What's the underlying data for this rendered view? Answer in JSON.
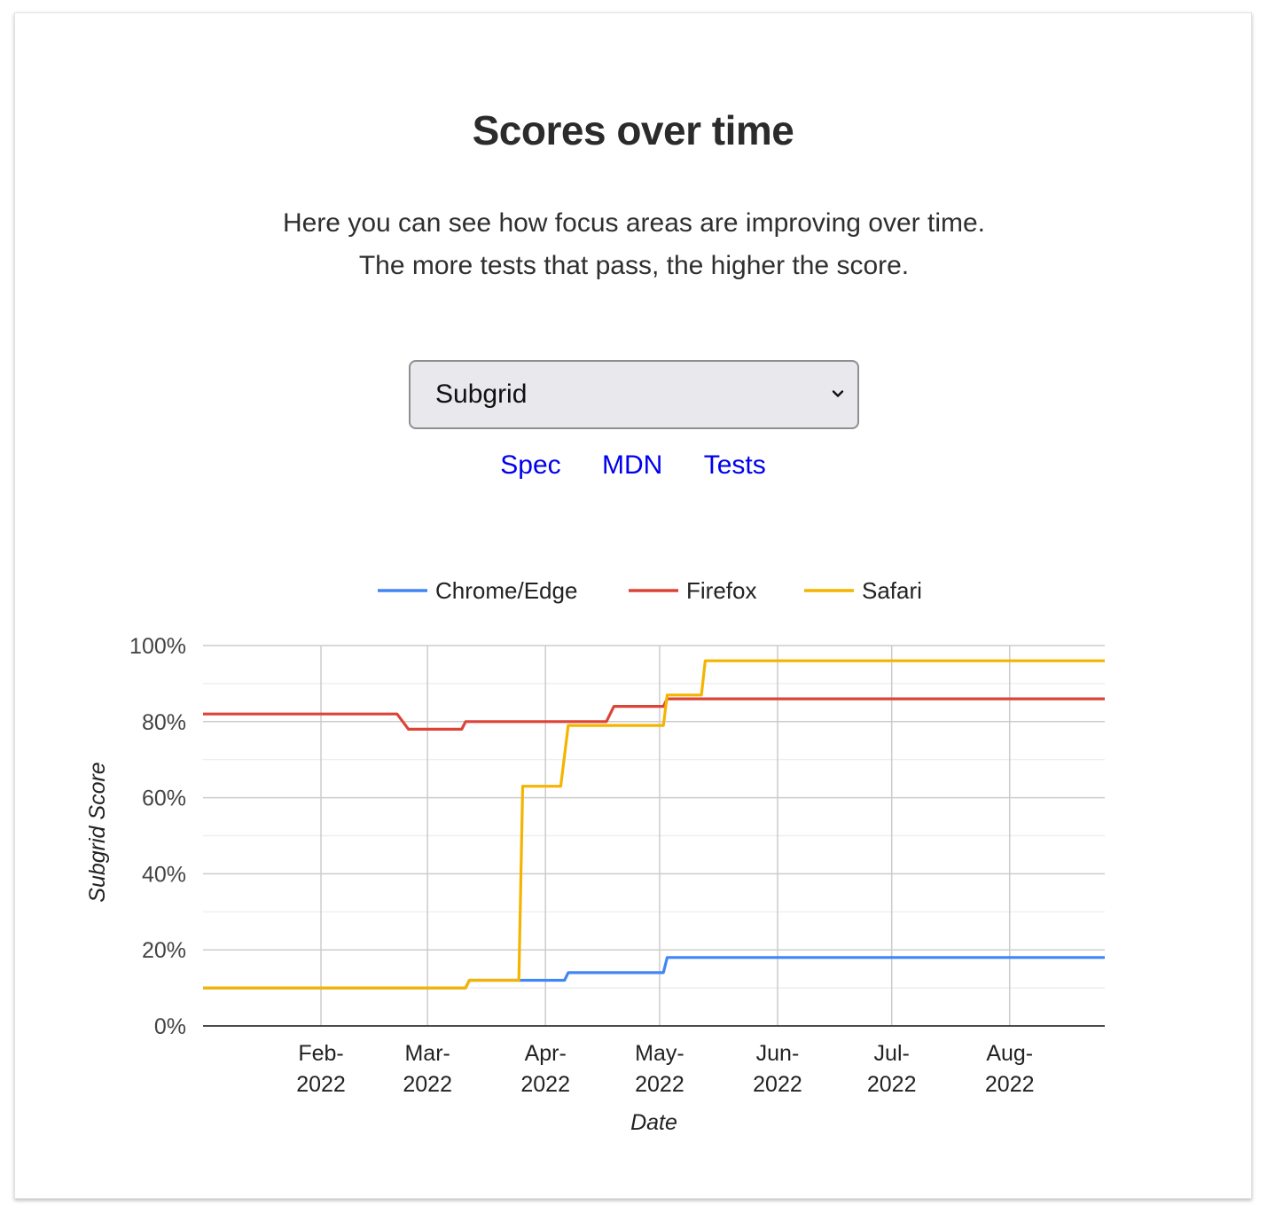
{
  "header": {
    "title": "Scores over time",
    "description": "Here you can see how focus areas are improving over time. The more tests that pass, the higher the score."
  },
  "select": {
    "selected": "Subgrid"
  },
  "links": [
    {
      "label": "Spec"
    },
    {
      "label": "MDN"
    },
    {
      "label": "Tests"
    }
  ],
  "chart_data": {
    "type": "line",
    "step": true,
    "xlabel": "Date",
    "ylabel": "Subgrid Score",
    "ylim": [
      0,
      100
    ],
    "xlim": [
      "2022-01-01",
      "2022-08-26"
    ],
    "yticks": [
      "0%",
      "20%",
      "40%",
      "60%",
      "80%",
      "100%"
    ],
    "xticks": [
      {
        "date": "2022-02-01",
        "line1": "Feb-",
        "line2": "2022"
      },
      {
        "date": "2022-03-01",
        "line1": "Mar-",
        "line2": "2022"
      },
      {
        "date": "2022-04-01",
        "line1": "Apr-",
        "line2": "2022"
      },
      {
        "date": "2022-05-01",
        "line1": "May-",
        "line2": "2022"
      },
      {
        "date": "2022-06-01",
        "line1": "Jun-",
        "line2": "2022"
      },
      {
        "date": "2022-07-01",
        "line1": "Jul-",
        "line2": "2022"
      },
      {
        "date": "2022-08-01",
        "line1": "Aug-",
        "line2": "2022"
      }
    ],
    "grid": true,
    "legend": "top",
    "series": [
      {
        "name": "Chrome/Edge",
        "color": "#4285f4",
        "points": [
          [
            "2022-01-01",
            10
          ],
          [
            "2022-03-11",
            10
          ],
          [
            "2022-03-12",
            12
          ],
          [
            "2022-04-06",
            12
          ],
          [
            "2022-04-07",
            14
          ],
          [
            "2022-05-02",
            14
          ],
          [
            "2022-05-03",
            18
          ],
          [
            "2022-08-26",
            18
          ]
        ]
      },
      {
        "name": "Firefox",
        "color": "#db4437",
        "points": [
          [
            "2022-01-01",
            82
          ],
          [
            "2022-02-21",
            82
          ],
          [
            "2022-02-24",
            78
          ],
          [
            "2022-03-10",
            78
          ],
          [
            "2022-03-11",
            80
          ],
          [
            "2022-04-17",
            80
          ],
          [
            "2022-04-19",
            84
          ],
          [
            "2022-05-02",
            84
          ],
          [
            "2022-05-03",
            86
          ],
          [
            "2022-08-26",
            86
          ]
        ]
      },
      {
        "name": "Safari",
        "color": "#f4b400",
        "points": [
          [
            "2022-01-01",
            10
          ],
          [
            "2022-03-11",
            10
          ],
          [
            "2022-03-12",
            12
          ],
          [
            "2022-03-25",
            12
          ],
          [
            "2022-03-26",
            63
          ],
          [
            "2022-04-05",
            63
          ],
          [
            "2022-04-07",
            79
          ],
          [
            "2022-05-02",
            79
          ],
          [
            "2022-05-03",
            87
          ],
          [
            "2022-05-12",
            87
          ],
          [
            "2022-05-13",
            96
          ],
          [
            "2022-08-26",
            96
          ]
        ]
      }
    ]
  }
}
